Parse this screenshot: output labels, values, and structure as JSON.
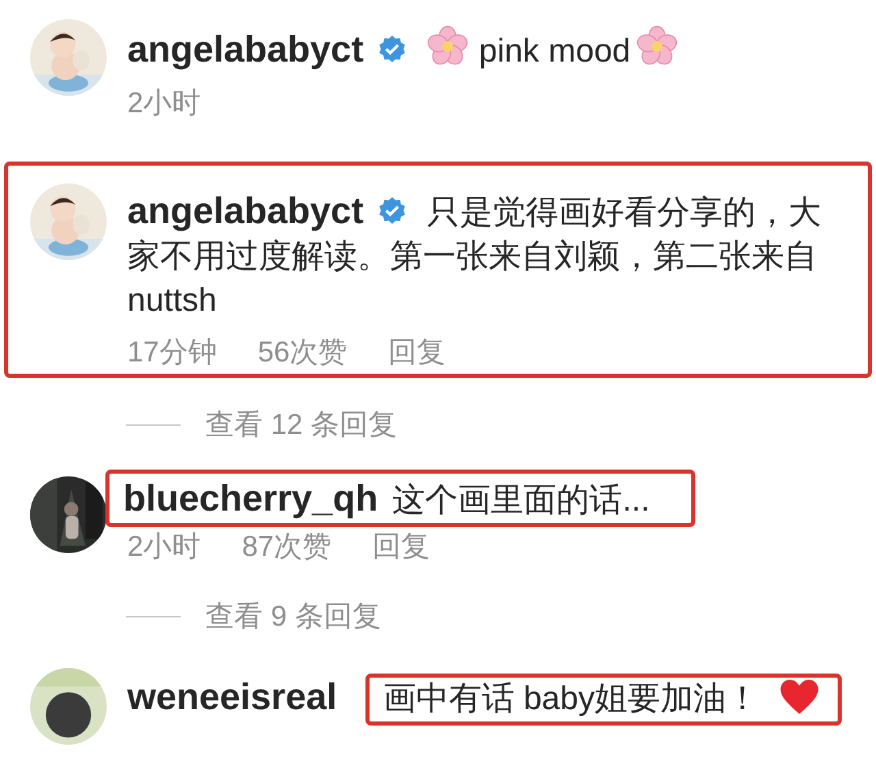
{
  "comments": [
    {
      "username": "angelababyct",
      "verified": true,
      "parts": [
        {
          "kind": "flower"
        },
        {
          "kind": "text",
          "text": "pink mood"
        },
        {
          "kind": "flower"
        }
      ],
      "time": "2小时",
      "boxed": false,
      "line_boxed": false,
      "text_boxed": false
    },
    {
      "username": "angelababyct",
      "verified": true,
      "parts": [
        {
          "kind": "text",
          "text": "只是觉得画好看分享的，大家不用过度解读。第一张来自刘颖，第二张来自nuttsh"
        }
      ],
      "time": "17分钟",
      "likes": "56次赞",
      "reply": "回复",
      "boxed": true,
      "line_boxed": false,
      "text_boxed": false,
      "view_replies": "查看 12 条回复"
    },
    {
      "username": "bluecherry_qh",
      "verified": false,
      "parts": [
        {
          "kind": "text",
          "text": "这个画里面的话..."
        }
      ],
      "time": "2小时",
      "likes": "87次赞",
      "reply": "回复",
      "boxed": false,
      "line_boxed": true,
      "text_boxed": false,
      "view_replies": "查看 9 条回复"
    },
    {
      "username": "weneeisreal",
      "verified": false,
      "parts": [
        {
          "kind": "text",
          "text": "画中有话 baby姐要加油！"
        },
        {
          "kind": "heart"
        }
      ],
      "boxed": false,
      "line_boxed": false,
      "text_boxed": true
    }
  ]
}
